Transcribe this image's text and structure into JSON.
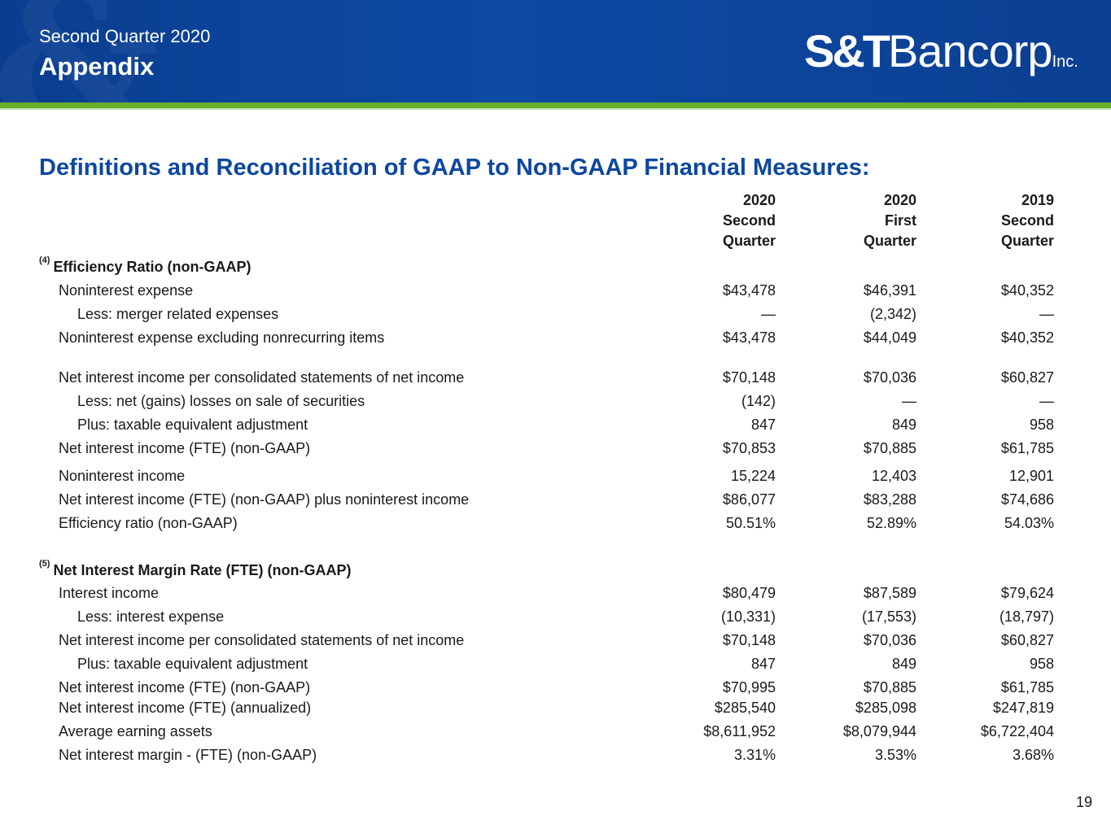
{
  "header": {
    "subtitle": "Second Quarter 2020",
    "title": "Appendix",
    "logo": {
      "part1": "S&T",
      "part2": "Bancorp",
      "part3": "Inc."
    }
  },
  "heading": "Definitions and Reconciliation of GAAP to Non-GAAP Financial Measures:",
  "columns": [
    {
      "year": "2020",
      "period": "Second",
      "label": "Quarter"
    },
    {
      "year": "2020",
      "period": "First",
      "label": "Quarter"
    },
    {
      "year": "2019",
      "period": "Second",
      "label": "Quarter"
    }
  ],
  "section4": {
    "note": "(4)",
    "title": "Efficiency Ratio (non-GAAP)",
    "rows": [
      {
        "label": "Noninterest expense",
        "values": [
          "$43,478",
          "$46,391",
          "$40,352"
        ]
      },
      {
        "label": "Less: merger related expenses",
        "values": [
          "—",
          "(2,342)",
          "—"
        ]
      },
      {
        "label": "Noninterest expense excluding nonrecurring items",
        "values": [
          "$43,478",
          "$44,049",
          "$40,352"
        ]
      },
      {
        "label": "Net interest income per consolidated statements of net income",
        "values": [
          "$70,148",
          "$70,036",
          "$60,827"
        ]
      },
      {
        "label": "Less: net (gains) losses on sale of securities",
        "values": [
          "(142)",
          "—",
          "—"
        ]
      },
      {
        "label": "Plus: taxable equivalent adjustment",
        "values": [
          "847",
          "849",
          "958"
        ]
      },
      {
        "label": "Net interest income (FTE) (non-GAAP)",
        "values": [
          "$70,853",
          "$70,885",
          "$61,785"
        ]
      },
      {
        "label": "Noninterest income",
        "values": [
          "15,224",
          "12,403",
          "12,901"
        ]
      },
      {
        "label": "Net interest income (FTE) (non-GAAP) plus noninterest income",
        "values": [
          "$86,077",
          "$83,288",
          "$74,686"
        ]
      },
      {
        "label": "Efficiency ratio (non-GAAP)",
        "values": [
          "50.51%",
          "52.89%",
          "54.03%"
        ]
      }
    ]
  },
  "section5": {
    "note": "(5)",
    "title": "Net Interest Margin Rate (FTE) (non-GAAP)",
    "rows": [
      {
        "label": "Interest income",
        "values": [
          "$80,479",
          "$87,589",
          "$79,624"
        ]
      },
      {
        "label": "Less: interest expense",
        "values": [
          "(10,331)",
          "(17,553)",
          "(18,797)"
        ]
      },
      {
        "label": "Net interest income per consolidated statements of net income",
        "values": [
          "$70,148",
          "$70,036",
          "$60,827"
        ]
      },
      {
        "label": "Plus: taxable equivalent adjustment",
        "values": [
          "847",
          "849",
          "958"
        ]
      },
      {
        "label": "Net interest income (FTE) (non-GAAP)",
        "values": [
          "$70,995",
          "$70,885",
          "$61,785"
        ]
      },
      {
        "label": "Net interest income (FTE) (annualized)",
        "values": [
          "$285,540",
          "$285,098",
          "$247,819"
        ]
      },
      {
        "label": "Average earning assets",
        "values": [
          "$8,611,952",
          "$8,079,944",
          "$6,722,404"
        ]
      },
      {
        "label": "Net interest margin - (FTE) (non-GAAP)",
        "values": [
          "3.31%",
          "3.53%",
          "3.68%"
        ]
      }
    ]
  },
  "page_number": "19"
}
